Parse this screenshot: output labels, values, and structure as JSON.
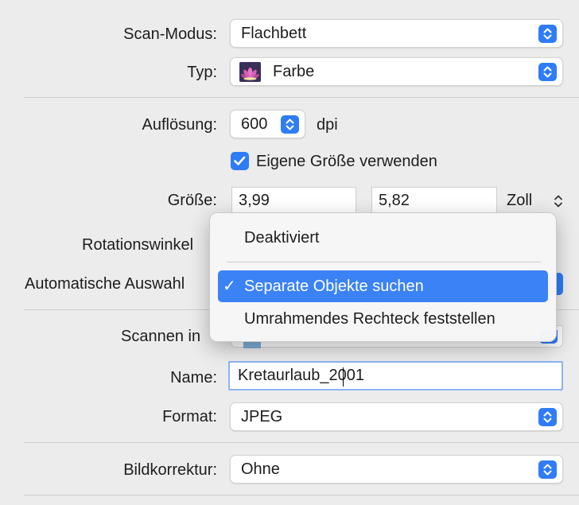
{
  "scan_mode": {
    "label": "Scan-Modus:",
    "value": "Flachbett"
  },
  "type": {
    "label": "Typ:",
    "value": "Farbe",
    "icon": "lotus-flower-icon"
  },
  "resolution": {
    "label": "Auflösung:",
    "value": "600",
    "unit": "dpi"
  },
  "custom_size": {
    "label": "Eigene Größe verwenden",
    "checked": true
  },
  "size": {
    "label": "Größe:",
    "width": "3,99",
    "height": "5,82",
    "unit": "Zoll"
  },
  "rotation": {
    "label": "Rotationswinkel"
  },
  "auto_select": {
    "label": "Automatische Auswahl",
    "menu": {
      "items": [
        "Deaktiviert",
        "Separate Objekte suchen",
        "Umrahmendes Rechteck feststellen"
      ],
      "selected_index": 1,
      "check_mark": "✓"
    }
  },
  "scan_to": {
    "label": "Scannen in"
  },
  "name": {
    "label": "Name:",
    "value": "Kretaurlaub_2001"
  },
  "format": {
    "label": "Format:",
    "value": "JPEG"
  },
  "image_correction": {
    "label": "Bildkorrektur:",
    "value": "Ohne"
  },
  "colors": {
    "accent": "#2f7cf6",
    "background": "#ececec",
    "menu_highlight": "#3b82f6"
  }
}
